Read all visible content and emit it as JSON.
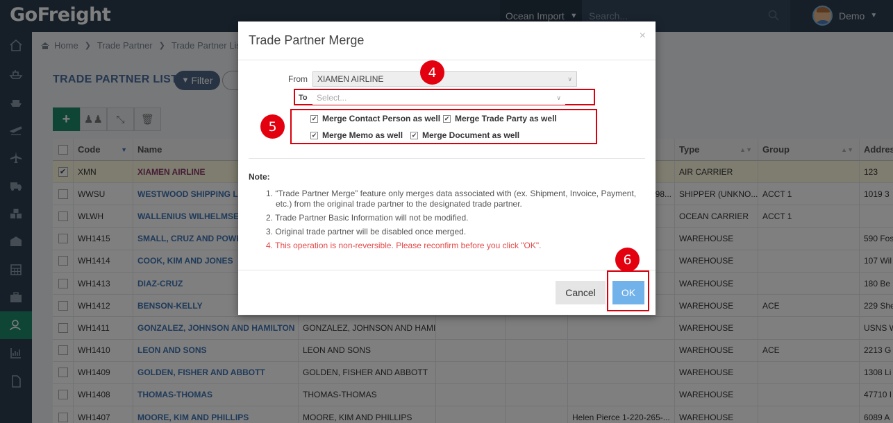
{
  "app": {
    "logo": "GoFreight"
  },
  "topbar": {
    "mode": "Ocean Import",
    "search_placeholder": "Search...",
    "user": "Demo"
  },
  "sidebar": {
    "icons": [
      "home-icon",
      "vessel-icon",
      "ship-icon",
      "plane-departure-icon",
      "plane-icon",
      "truck-icon",
      "warehouse-boxes-icon",
      "building-icon",
      "calculator-icon",
      "briefcase-icon",
      "trade-partner-icon",
      "chart-icon",
      "document-icon"
    ],
    "active_index": 10
  },
  "breadcrumb": [
    "Home",
    "Trade Partner",
    "Trade Partner List"
  ],
  "page": {
    "title": "TRADE PARTNER LIST",
    "filter_label": "Filter"
  },
  "toolbar": {
    "add_label": "+"
  },
  "table": {
    "headers": {
      "code": "Code",
      "name": "Name",
      "type": "Type",
      "group": "Group",
      "address": "Addres"
    },
    "rows": [
      {
        "code": "XMN",
        "name": "XIAMEN AIRLINE",
        "name2": "",
        "contact": "",
        "type": "AIR CARRIER",
        "group": "",
        "address": "123",
        "checked": true,
        "selected": true
      },
      {
        "code": "WWSU",
        "name": "WESTWOOD SHIPPING LINES",
        "name2": "",
        "contact": "",
        "type": "SHIPPER (UNKNO...",
        "group": "ACCT 1",
        "address": "1019 3",
        "checked": false
      },
      {
        "code": "WLWH",
        "name": "WALLENIUS WILHELMSEN",
        "name2": "",
        "contact": "",
        "type": "OCEAN CARRIER",
        "group": "ACCT 1",
        "address": "",
        "checked": false
      },
      {
        "code": "WH1415",
        "name": "SMALL, CRUZ AND POWERS",
        "name2": "",
        "contact": "",
        "type": "WAREHOUSE",
        "group": "",
        "address": "590 Fos",
        "checked": false
      },
      {
        "code": "WH1414",
        "name": "COOK, KIM AND JONES",
        "name2": "",
        "contact": "",
        "type": "WAREHOUSE",
        "group": "",
        "address": "107 Wil",
        "checked": false
      },
      {
        "code": "WH1413",
        "name": "DIAZ-CRUZ",
        "name2": "",
        "contact": "",
        "type": "WAREHOUSE",
        "group": "",
        "address": "180 Be",
        "checked": false
      },
      {
        "code": "WH1412",
        "name": "BENSON-KELLY",
        "name2": "",
        "contact": "",
        "type": "WAREHOUSE",
        "group": "ACE",
        "address": "229 She",
        "checked": false
      },
      {
        "code": "WH1411",
        "name": "GONZALEZ, JOHNSON AND HAMILTON",
        "name2": "GONZALEZ, JOHNSON AND HAMI...",
        "contact": "",
        "type": "WAREHOUSE",
        "group": "",
        "address": "USNS W",
        "checked": false
      },
      {
        "code": "WH1410",
        "name": "LEON AND SONS",
        "name2": "LEON AND SONS",
        "contact": "",
        "type": "WAREHOUSE",
        "group": "ACE",
        "address": "2213 G",
        "checked": false
      },
      {
        "code": "WH1409",
        "name": "GOLDEN, FISHER AND ABBOTT",
        "name2": "GOLDEN, FISHER AND ABBOTT",
        "contact": "",
        "type": "WAREHOUSE",
        "group": "",
        "address": "1308 Li",
        "checked": false
      },
      {
        "code": "WH1408",
        "name": "THOMAS-THOMAS",
        "name2": "THOMAS-THOMAS",
        "contact": "",
        "type": "WAREHOUSE",
        "group": "",
        "address": "47710 I",
        "checked": false
      },
      {
        "code": "WH1407",
        "name": "MOORE, KIM AND PHILLIPS",
        "name2": "MOORE, KIM AND PHILLIPS",
        "contact": "Helen Pierce 1-220-265-...",
        "type": "WAREHOUSE",
        "group": "",
        "address": "6089 A",
        "checked": false
      }
    ],
    "partial_cell_row1": "98..."
  },
  "modal": {
    "title": "Trade Partner Merge",
    "close": "×",
    "from_label": "From",
    "from_value": "XIAMEN AIRLINE",
    "to_label": "To",
    "to_placeholder": "Select...",
    "options": {
      "contact": "Merge Contact Person as well",
      "party": "Merge Trade Party as well",
      "memo": "Merge Memo as well",
      "document": "Merge Document as well"
    },
    "note_title": "Note:",
    "notes": [
      "1. “Trade Partner Merge” feature only merges data associated with (ex. Shipment, Invoice, Payment, etc.) from the original trade partner to the designated trade partner.",
      "2. Trade Partner Basic Information will not be modified.",
      "3. Original trade partner will be disabled once merged.",
      "4. This operation is non-reversible. Please reconfirm before you click \"OK\"."
    ],
    "cancel_label": "Cancel",
    "ok_label": "OK"
  },
  "annotations": {
    "step4": "4",
    "step5": "5",
    "step6": "6"
  },
  "colors": {
    "accent": "#1f8b6a",
    "header": "#2d3e50",
    "annotation": "#e3000f",
    "ok": "#72b2ea"
  }
}
